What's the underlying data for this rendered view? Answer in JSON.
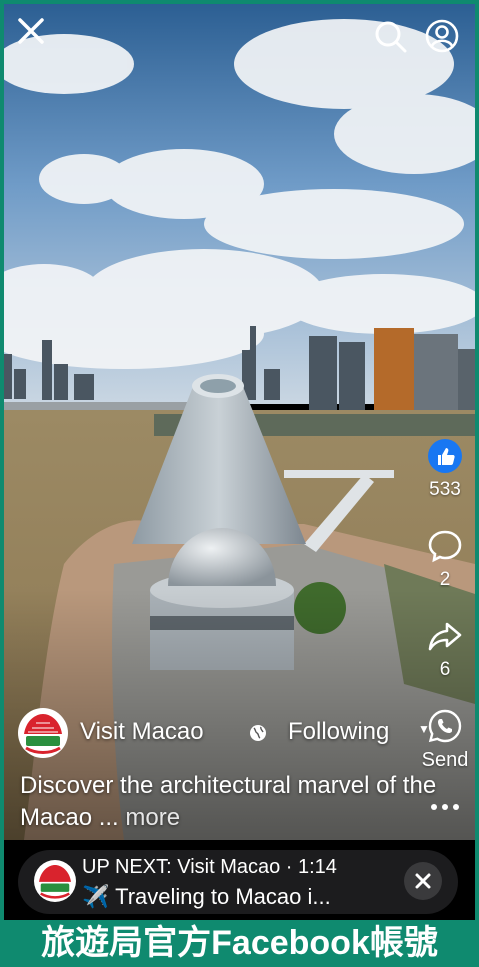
{
  "video": {
    "description": "aerial view of Macao Science Center with city skyline"
  },
  "top_bar": {
    "close_icon": "close-icon",
    "search_icon": "search-icon",
    "profile_icon": "profile-icon"
  },
  "actions": {
    "like_count": "533",
    "comment_count": "2",
    "share_count": "6",
    "send_label": "Send",
    "like_color": "#1877f2"
  },
  "author": {
    "name": "Visit Macao",
    "follow_label": "Following"
  },
  "caption": {
    "text": "Discover the architectural marvel of the Macao ...",
    "more_label": "more"
  },
  "up_next": {
    "line1": "UP NEXT: Visit Macao · 1:14",
    "line2": "✈️ Traveling to Macao i..."
  },
  "banner": {
    "text": "旅遊局官方Facebook帳號",
    "color": "#0f8a6f"
  }
}
